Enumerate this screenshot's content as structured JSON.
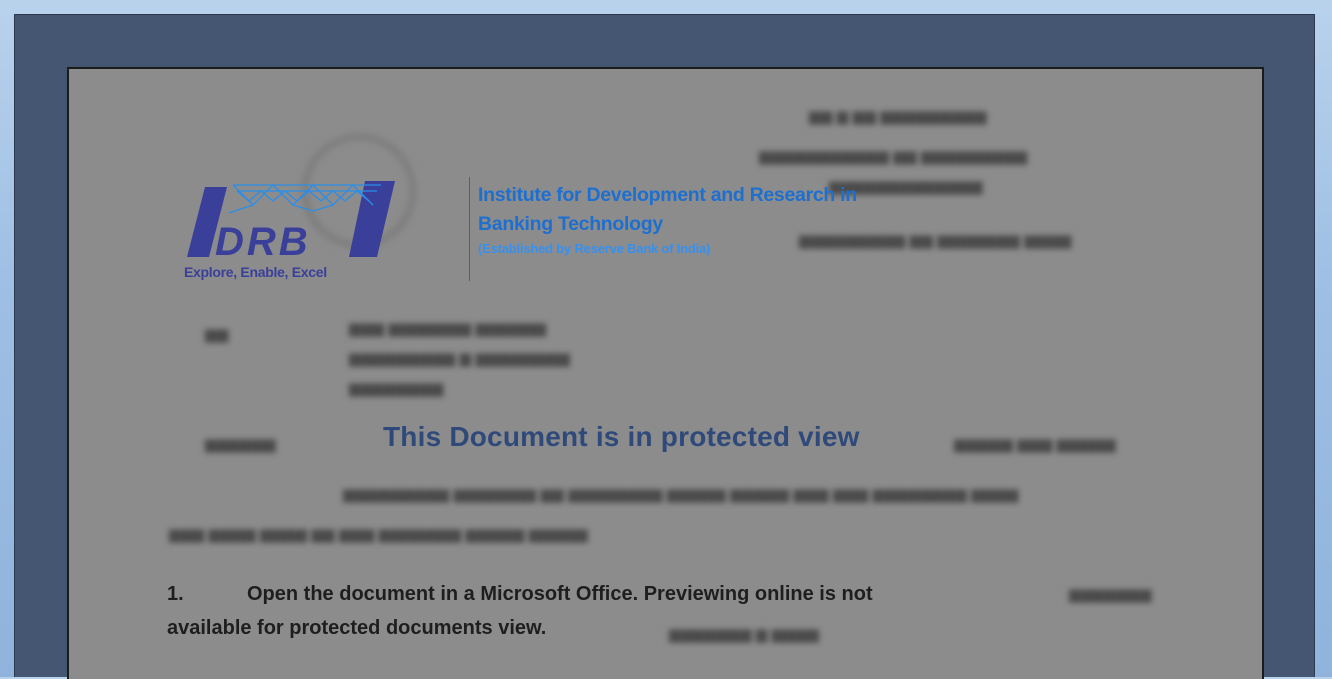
{
  "logo": {
    "mark_text": "IDRBT",
    "tagline": "Explore, Enable, Excel",
    "line1": "Institute for Development and Research in",
    "line2": "Banking Technology",
    "subline": "(Established by Reserve Bank of India)"
  },
  "protected": {
    "title": "This Document is in protected view"
  },
  "notice": {
    "number": "1.",
    "line1": "Open the document in a Microsoft Office. Previewing online is not",
    "line2": "available  for protected documents view."
  },
  "colors": {
    "frame": "#445672",
    "document_bg": "#8c8c8c",
    "logo_blue": "#1d6fd0",
    "logo_purple": "#3a3f9a",
    "title_blue": "#2f4a7a"
  }
}
